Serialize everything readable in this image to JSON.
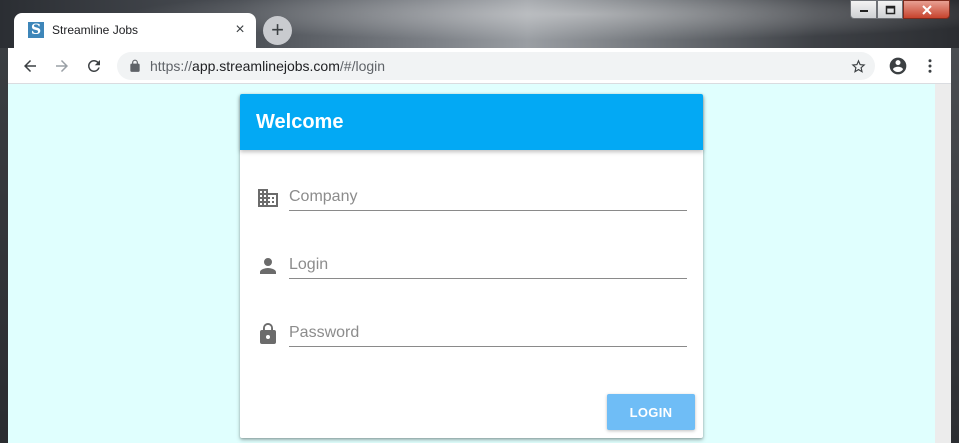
{
  "browser": {
    "tab": {
      "title": "Streamline Jobs",
      "favicon_letter": "S",
      "close_glyph": "×"
    },
    "new_tab_glyph": "+",
    "address": {
      "scheme": "https://",
      "host": "app.streamlinejobs.com",
      "path": "/#/login"
    },
    "icons": {
      "back": "arrow-back-icon",
      "forward": "arrow-forward-icon",
      "reload": "reload-icon",
      "lock": "lock-icon",
      "bookmark": "star-icon",
      "profile": "account-circle-icon",
      "menu": "more-vert-icon"
    }
  },
  "login_card": {
    "title": "Welcome",
    "fields": [
      {
        "name": "company",
        "placeholder": "Company",
        "value": "",
        "icon": "building-icon"
      },
      {
        "name": "login",
        "placeholder": "Login",
        "value": "",
        "icon": "person-icon"
      },
      {
        "name": "password",
        "placeholder": "Password",
        "value": "",
        "icon": "lock-icon"
      }
    ],
    "submit_label": "LOGIN"
  },
  "colors": {
    "page_background": "#e0fffe",
    "header_background": "#03a9f4",
    "button_background": "#6fbdf6"
  }
}
